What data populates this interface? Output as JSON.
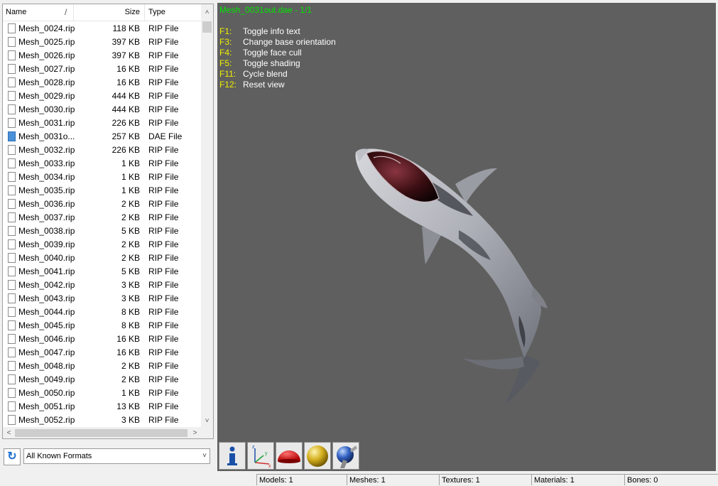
{
  "file_list": {
    "columns": {
      "name": "Name",
      "size": "Size",
      "type": "Type"
    },
    "rows": [
      {
        "name": "Mesh_0024.rip",
        "size": "118 KB",
        "type": "RIP File"
      },
      {
        "name": "Mesh_0025.rip",
        "size": "397 KB",
        "type": "RIP File"
      },
      {
        "name": "Mesh_0026.rip",
        "size": "397 KB",
        "type": "RIP File"
      },
      {
        "name": "Mesh_0027.rip",
        "size": "16 KB",
        "type": "RIP File"
      },
      {
        "name": "Mesh_0028.rip",
        "size": "16 KB",
        "type": "RIP File"
      },
      {
        "name": "Mesh_0029.rip",
        "size": "444 KB",
        "type": "RIP File"
      },
      {
        "name": "Mesh_0030.rip",
        "size": "444 KB",
        "type": "RIP File"
      },
      {
        "name": "Mesh_0031.rip",
        "size": "226 KB",
        "type": "RIP File"
      },
      {
        "name": "Mesh_0031o...",
        "size": "257 KB",
        "type": "DAE File",
        "icon": "dae-file-icon"
      },
      {
        "name": "Mesh_0032.rip",
        "size": "226 KB",
        "type": "RIP File"
      },
      {
        "name": "Mesh_0033.rip",
        "size": "1 KB",
        "type": "RIP File"
      },
      {
        "name": "Mesh_0034.rip",
        "size": "1 KB",
        "type": "RIP File"
      },
      {
        "name": "Mesh_0035.rip",
        "size": "1 KB",
        "type": "RIP File"
      },
      {
        "name": "Mesh_0036.rip",
        "size": "2 KB",
        "type": "RIP File"
      },
      {
        "name": "Mesh_0037.rip",
        "size": "2 KB",
        "type": "RIP File"
      },
      {
        "name": "Mesh_0038.rip",
        "size": "5 KB",
        "type": "RIP File"
      },
      {
        "name": "Mesh_0039.rip",
        "size": "2 KB",
        "type": "RIP File"
      },
      {
        "name": "Mesh_0040.rip",
        "size": "2 KB",
        "type": "RIP File"
      },
      {
        "name": "Mesh_0041.rip",
        "size": "5 KB",
        "type": "RIP File"
      },
      {
        "name": "Mesh_0042.rip",
        "size": "3 KB",
        "type": "RIP File"
      },
      {
        "name": "Mesh_0043.rip",
        "size": "3 KB",
        "type": "RIP File"
      },
      {
        "name": "Mesh_0044.rip",
        "size": "8 KB",
        "type": "RIP File"
      },
      {
        "name": "Mesh_0045.rip",
        "size": "8 KB",
        "type": "RIP File"
      },
      {
        "name": "Mesh_0046.rip",
        "size": "16 KB",
        "type": "RIP File"
      },
      {
        "name": "Mesh_0047.rip",
        "size": "16 KB",
        "type": "RIP File"
      },
      {
        "name": "Mesh_0048.rip",
        "size": "2 KB",
        "type": "RIP File"
      },
      {
        "name": "Mesh_0049.rip",
        "size": "2 KB",
        "type": "RIP File"
      },
      {
        "name": "Mesh_0050.rip",
        "size": "1 KB",
        "type": "RIP File"
      },
      {
        "name": "Mesh_0051.rip",
        "size": "13 KB",
        "type": "RIP File"
      },
      {
        "name": "Mesh_0052.rip",
        "size": "3 KB",
        "type": "RIP File"
      }
    ]
  },
  "format_bar": {
    "selected": "All Known Formats"
  },
  "viewport": {
    "title": "Mesh_0031out.dae - 1/1",
    "hotkeys": [
      {
        "key": "F1:",
        "desc": "Toggle info text"
      },
      {
        "key": "F3:",
        "desc": "Change base orientation"
      },
      {
        "key": "F4:",
        "desc": "Toggle face cull"
      },
      {
        "key": "F5:",
        "desc": "Toggle shading"
      },
      {
        "key": "F11:",
        "desc": "Cycle blend"
      },
      {
        "key": "F12:",
        "desc": "Reset view"
      }
    ],
    "colors": {
      "background": "#5f5f5f",
      "title": "#00e600",
      "hotkey": "#f0f000",
      "text": "#ffffff"
    }
  },
  "toolbar": {
    "buttons": [
      {
        "name": "info-button",
        "icon": "info-icon"
      },
      {
        "name": "axes-button",
        "icon": "axes-icon"
      },
      {
        "name": "hemisphere-button",
        "icon": "red-hemisphere-icon"
      },
      {
        "name": "shaded-sphere-button",
        "icon": "gold-sphere-icon"
      },
      {
        "name": "textured-sphere-button",
        "icon": "textured-sphere-icon"
      }
    ]
  },
  "status": {
    "models": "Models: 1",
    "meshes": "Meshes: 1",
    "textures": "Textures: 1",
    "materials": "Materials: 1",
    "bones": "Bones: 0"
  }
}
